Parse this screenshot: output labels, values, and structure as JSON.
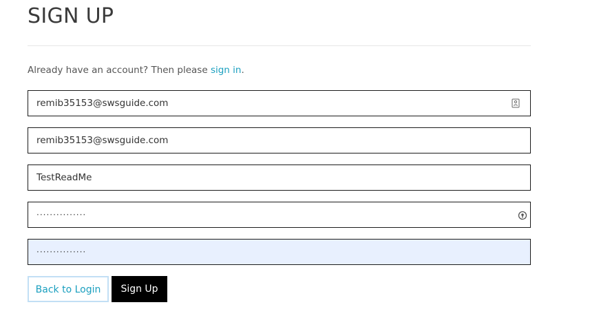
{
  "page": {
    "title": "SIGN UP"
  },
  "signin_prompt": {
    "text": "Already have an account? Then please ",
    "link_label": "sign in",
    "suffix": "."
  },
  "fields": [
    {
      "value": "remib35153@swsguide.com",
      "icon": "contact-card-icon"
    },
    {
      "value": "remib35153@swsguide.com"
    },
    {
      "value": "TestReadMe"
    },
    {
      "value": "···············",
      "icon": "password-key-icon"
    },
    {
      "value": "···············",
      "autofilled": true
    }
  ],
  "buttons": {
    "back_label": "Back to Login",
    "signup_label": "Sign Up"
  },
  "colors": {
    "link": "#1a9fbf",
    "primary_button": "#000000",
    "autofill_bg": "#e8f0fe",
    "back_button_border": "#c2dff5"
  }
}
